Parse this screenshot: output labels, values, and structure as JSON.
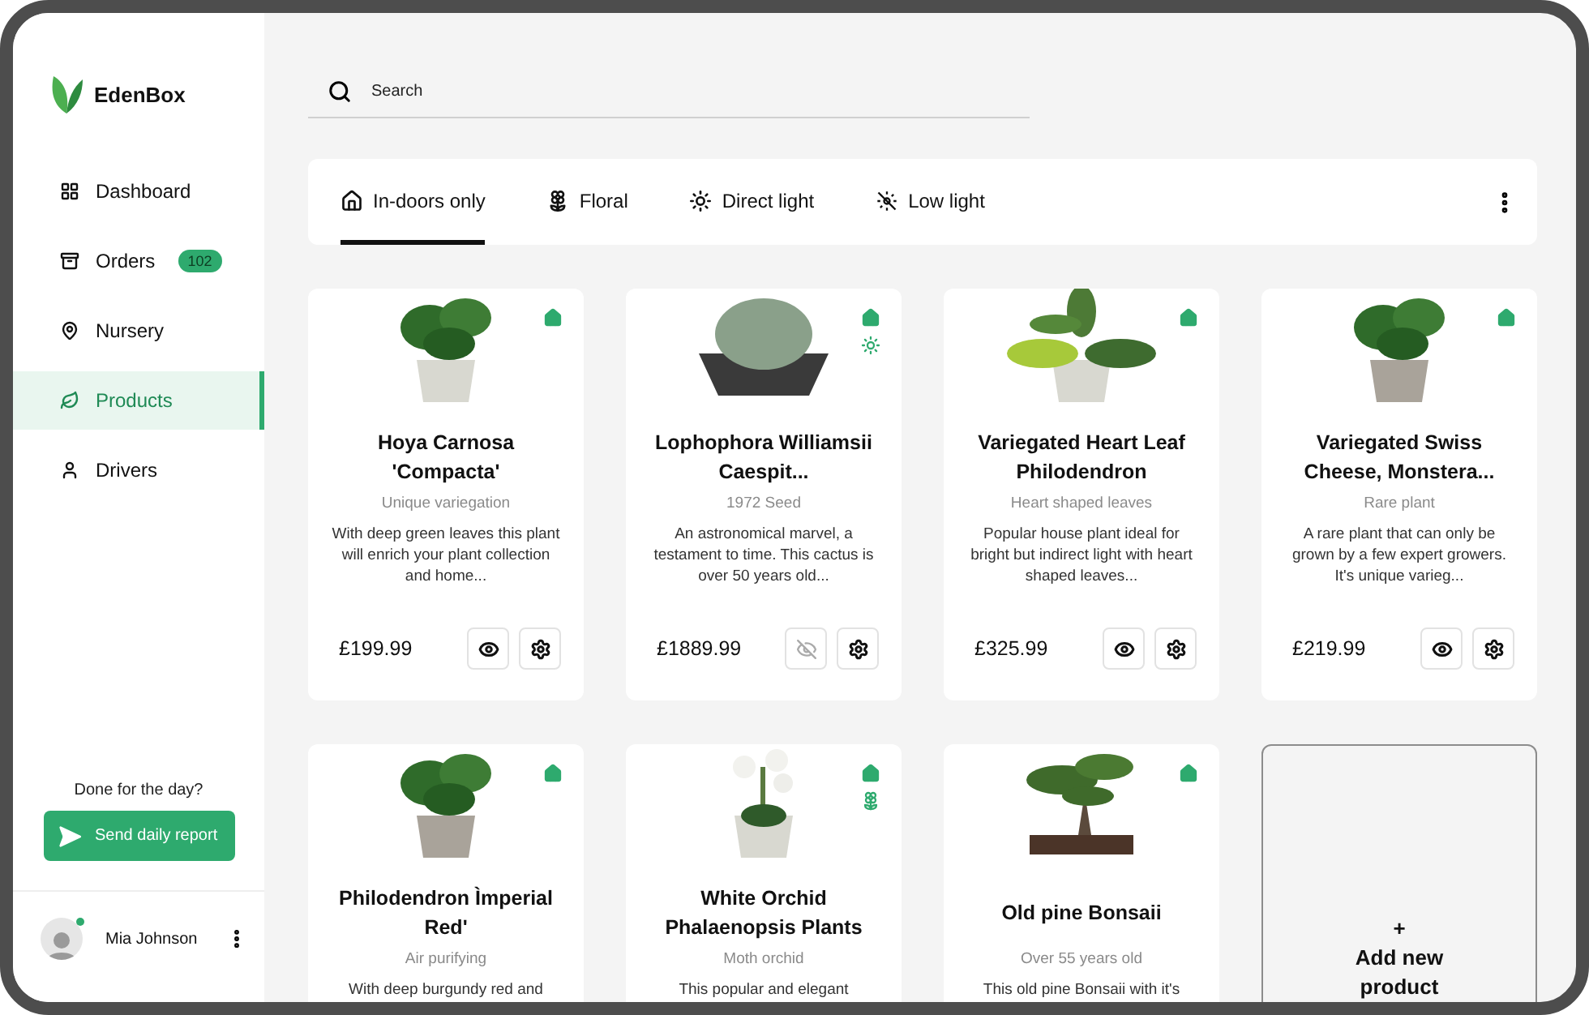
{
  "brand": {
    "name": "EdenBox"
  },
  "nav": [
    {
      "label": "Dashboard",
      "kind": "grid",
      "selected": false
    },
    {
      "label": "Orders",
      "kind": "orders",
      "selected": false,
      "badge": "102"
    },
    {
      "label": "Nursery",
      "kind": "pin",
      "selected": false
    },
    {
      "label": "Products",
      "kind": "leaf",
      "selected": true
    },
    {
      "label": "Drivers",
      "kind": "driver",
      "selected": false
    }
  ],
  "report": {
    "prompt": "Done for the day?",
    "button": "Send daily report"
  },
  "user": {
    "name": "Mia Johnson",
    "online": true
  },
  "search": {
    "placeholder": "Search"
  },
  "filters": [
    {
      "label": "In-doors only",
      "kind": "indoor",
      "selected": true
    },
    {
      "label": "Floral",
      "kind": "floral",
      "selected": false
    },
    {
      "label": "Direct light",
      "kind": "sun",
      "selected": false
    },
    {
      "label": "Low light",
      "kind": "lowlight",
      "selected": false
    }
  ],
  "products": [
    {
      "name": "Hoya Carnosa 'Compacta'",
      "subtitle": "Unique variegation",
      "description": "With deep green leaves this plant will enrich your plant collection and home...",
      "price": "£199.99",
      "visible": true,
      "tags": [
        {
          "kind": "indoor"
        }
      ]
    },
    {
      "name": "Lophophora Williamsii Caespit...",
      "subtitle": "1972 Seed",
      "description": "An astronomical marvel, a testament to time. This cactus is over 50 years old...",
      "price": "£1889.99",
      "visible": false,
      "tags": [
        {
          "kind": "indoor"
        },
        {
          "kind": "sun"
        }
      ]
    },
    {
      "name": "Variegated Heart Leaf Philodendron",
      "subtitle": "Heart shaped leaves",
      "description": "Popular house plant ideal for bright but indirect light with heart shaped leaves...",
      "price": "£325.99",
      "visible": true,
      "tags": [
        {
          "kind": "indoor"
        }
      ]
    },
    {
      "name": "Variegated Swiss Cheese, Monstera...",
      "subtitle": "Rare plant",
      "description": "A rare plant that can only be grown by a few expert growers. It's unique varieg...",
      "price": "£219.99",
      "visible": true,
      "tags": [
        {
          "kind": "indoor"
        }
      ]
    },
    {
      "name": "Philodendron Ìmperial Red'",
      "subtitle": "Air purifying",
      "description": "With deep burgundy red and",
      "tags": [
        {
          "kind": "indoor"
        }
      ]
    },
    {
      "name": "White Orchid Phalaenopsis Plants",
      "subtitle": "Moth orchid",
      "description": "This popular and elegant",
      "tags": [
        {
          "kind": "indoor"
        },
        {
          "kind": "floral"
        }
      ]
    },
    {
      "name": "Old pine Bonsaii",
      "subtitle": "Over 55 years old",
      "description": "This old pine Bonsaii with it's",
      "tags": [
        {
          "kind": "indoor"
        }
      ]
    }
  ],
  "add_card": {
    "plus": "+",
    "label": "Add new product"
  }
}
